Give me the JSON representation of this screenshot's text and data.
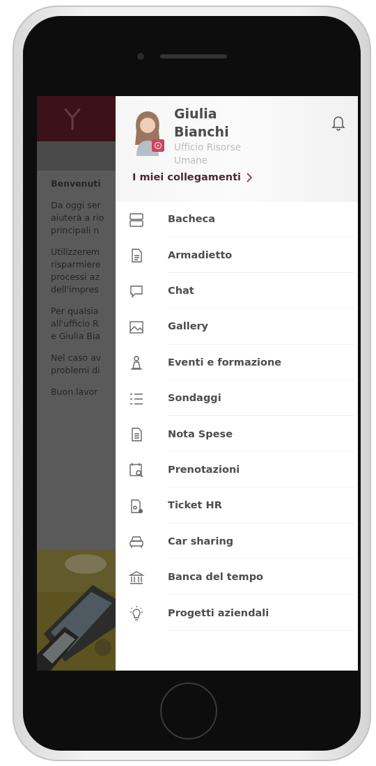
{
  "background_screen": {
    "paragraphs": [
      {
        "kind": "heading",
        "lines": [
          "Benvenuti"
        ]
      },
      {
        "kind": "text",
        "lines": [
          "Da oggi ser",
          "aiuterà a rio",
          "principali n"
        ]
      },
      {
        "kind": "text",
        "lines": [
          "Utilizzerem",
          "risparmiere",
          "processi az",
          "dell'impres"
        ]
      },
      {
        "kind": "text",
        "lines": [
          "Per qualsia",
          "all'ufficio R",
          "e Giulia Bia"
        ]
      },
      {
        "kind": "text",
        "lines": [
          "Nel caso av",
          "problemi di"
        ]
      },
      {
        "kind": "text",
        "lines": [
          "Buon lavor"
        ]
      }
    ]
  },
  "drawer": {
    "profile": {
      "name": "Giulia Bianchi",
      "department": "Ufficio Risorse Umane"
    },
    "links_label": "I miei collegamenti",
    "items": [
      {
        "label": "Bacheca"
      },
      {
        "label": "Armadietto"
      },
      {
        "label": "Chat"
      },
      {
        "label": "Gallery"
      },
      {
        "label": "Eventi e formazione"
      },
      {
        "label": "Sondaggi"
      },
      {
        "label": "Nota Spese"
      },
      {
        "label": "Prenotazioni"
      },
      {
        "label": "Ticket HR"
      },
      {
        "label": "Car sharing"
      },
      {
        "label": "Banca del tempo"
      },
      {
        "label": "Progetti aziendali"
      }
    ]
  }
}
